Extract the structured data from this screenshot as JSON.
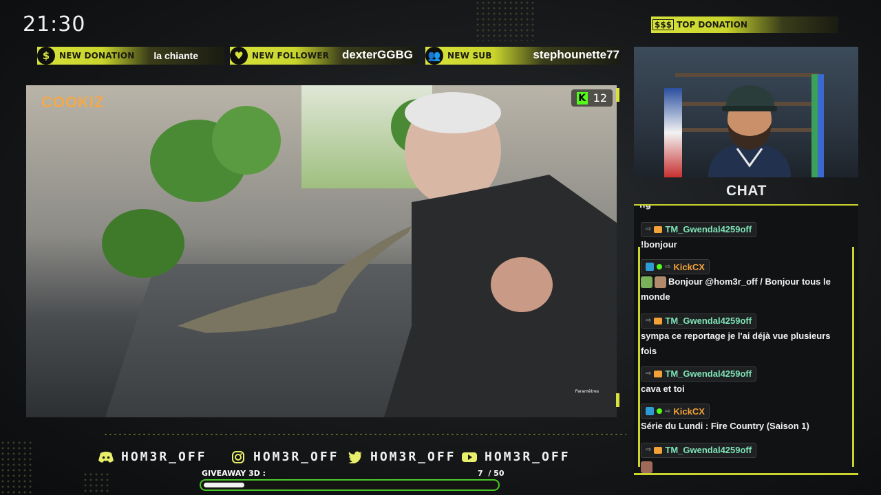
{
  "clock": "21:30",
  "alerts": [
    {
      "icon": "dollar-icon",
      "label": "NEW DONATION",
      "value": "la chiante"
    },
    {
      "icon": "heart-icon",
      "label": "NEW FOLLOWER",
      "value": "dexterGGBG"
    },
    {
      "icon": "users-icon",
      "label": "NEW SUB",
      "value": "stephounette77"
    }
  ],
  "top_donation": {
    "icon_text": "$$$",
    "label": "TOP DONATION"
  },
  "video": {
    "brand": "COOKIZ",
    "viewer_count": "12",
    "params_label": "Paramètres"
  },
  "socials": [
    {
      "platform": "discord",
      "icon": "discord-icon",
      "handle": "HOM3R_OFF"
    },
    {
      "platform": "instagram",
      "icon": "instagram-icon",
      "handle": "HOM3R_OFF"
    },
    {
      "platform": "twitter",
      "icon": "twitter-icon",
      "handle": "HOM3R_OFF"
    },
    {
      "platform": "youtube",
      "icon": "youtube-icon",
      "handle": "HOM3R_OFF"
    }
  ],
  "giveaway": {
    "label": "GIVEAWAY 3D :",
    "current": "7",
    "total": "50",
    "count_text": "7  / 50",
    "progress": 0.14
  },
  "chat": {
    "title": "CHAT",
    "cut_text": "ng",
    "messages": [
      {
        "user": "TM_Gwendal4259off",
        "color": "#7de3b6",
        "text": "!bonjour"
      },
      {
        "user": "KickCX",
        "color": "#f3a238",
        "text": "Bonjour @hom3r_off / Bonjour tous le monde"
      },
      {
        "user": "TM_Gwendal4259off",
        "color": "#7de3b6",
        "text": "sympa ce reportage je l'ai déjà vue plusieurs fois"
      },
      {
        "user": "TM_Gwendal4259off",
        "color": "#7de3b6",
        "text": "cava et toi"
      },
      {
        "user": "KickCX",
        "color": "#f3a238",
        "text": "Série du Lundi : Fire Country (Saison 1)"
      },
      {
        "user": "TM_Gwendal4259off",
        "color": "#7de3b6",
        "text": ""
      }
    ]
  },
  "colors": {
    "accent": "#d7e23c",
    "kick_green": "#53fc18",
    "progress_border": "#4ac82a"
  }
}
